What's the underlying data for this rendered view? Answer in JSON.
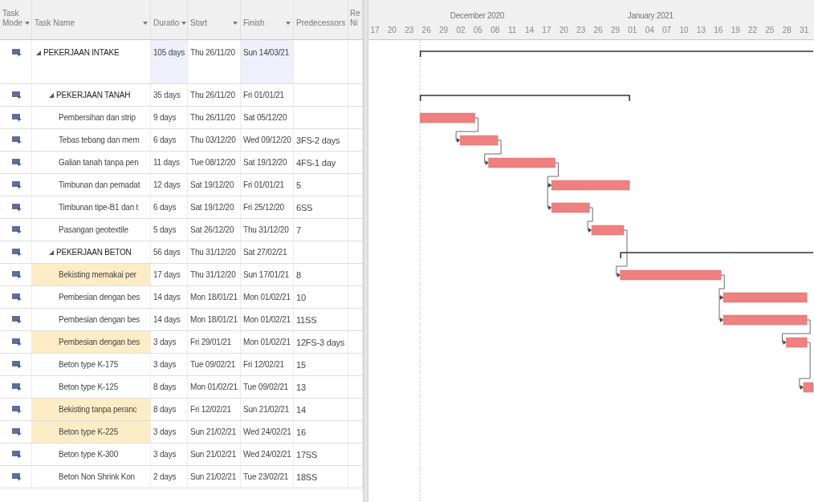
{
  "columns": [
    {
      "label": "Task Mode"
    },
    {
      "label": "Task Name"
    },
    {
      "label": "Duratio"
    },
    {
      "label": "Start"
    },
    {
      "label": "Finish"
    },
    {
      "label": "Predecessors"
    },
    {
      "label": "Re Ni"
    }
  ],
  "timeline": {
    "months": [
      "December 2020",
      "January 2021"
    ],
    "days": [
      "17",
      "20",
      "23",
      "26",
      "29",
      "02",
      "05",
      "08",
      "11",
      "14",
      "17",
      "20",
      "23",
      "26",
      "29",
      "01",
      "04",
      "07",
      "10",
      "13",
      "16",
      "19",
      "22",
      "25",
      "28",
      "31"
    ]
  },
  "tasks": [
    {
      "kind": "summary",
      "name": "PEKERJAAN INTAKE",
      "duration": "105 days",
      "start": "Thu 26/11/20",
      "finish": "Sun 14/03/21",
      "expanded": true,
      "name_highlighted": false,
      "dates_highlighted": true,
      "children": [
        {
          "kind": "summary",
          "name": "PEKERJAAN TANAH",
          "duration": "35 days",
          "start": "Thu 26/11/20",
          "finish": "Fri 01/01/21",
          "expanded": true,
          "name_highlighted": false,
          "dates_highlighted": false,
          "children": [
            {
              "kind": "task",
              "name": "Pembersihan dan strip",
              "duration": "9 days",
              "start": "Thu 26/11/20",
              "finish": "Sat 05/12/20",
              "name_highlighted": false,
              "dates_highlighted": false
            },
            {
              "kind": "task",
              "name": "Tebas tebang dan mem",
              "duration": "6 days",
              "start": "Thu 03/12/20",
              "finish": "Wed 09/12/20",
              "predecessors": "3FS-2 days",
              "name_highlighted": false,
              "dates_highlighted": false
            },
            {
              "kind": "task",
              "name": "Galian tanah tanpa pen",
              "duration": "11 days",
              "start": "Tue 08/12/20",
              "finish": "Sat 19/12/20",
              "predecessors": "4FS-1 day",
              "name_highlighted": false,
              "dates_highlighted": false
            },
            {
              "kind": "task",
              "name": "Timbunan dan pemadat",
              "duration": "12 days",
              "start": "Sat 19/12/20",
              "finish": "Fri 01/01/21",
              "predecessors": "5",
              "name_highlighted": false,
              "dates_highlighted": false
            },
            {
              "kind": "task",
              "name": "Timbunan tipe-B1 dan t",
              "duration": "6 days",
              "start": "Sat 19/12/20",
              "finish": "Fri 25/12/20",
              "predecessors": "6SS",
              "name_highlighted": false,
              "dates_highlighted": false
            },
            {
              "kind": "task",
              "name": "Pasangan geotextile",
              "duration": "5 days",
              "start": "Sat 26/12/20",
              "finish": "Thu 31/12/20",
              "predecessors": "7",
              "name_highlighted": false,
              "dates_highlighted": false
            }
          ]
        },
        {
          "kind": "summary",
          "name": "PEKERJAAN BETON",
          "duration": "56 days",
          "start": "Thu 31/12/20",
          "finish": "Sat 27/02/21",
          "expanded": true,
          "name_highlighted": false,
          "dates_highlighted": false,
          "children": [
            {
              "kind": "task",
              "name": "Bekisting memakai per",
              "duration": "17 days",
              "start": "Thu 31/12/20",
              "finish": "Sun 17/01/21",
              "predecessors": "8",
              "name_highlighted": true,
              "dates_highlighted": false
            },
            {
              "kind": "task",
              "name": "Pembesian dengan bes",
              "duration": "14 days",
              "start": "Mon 18/01/21",
              "finish": "Mon 01/02/21",
              "predecessors": "10",
              "name_highlighted": false,
              "dates_highlighted": false
            },
            {
              "kind": "task",
              "name": "Pembesian dengan bes",
              "duration": "14 days",
              "start": "Mon 18/01/21",
              "finish": "Mon 01/02/21",
              "predecessors": "11SS",
              "name_highlighted": false,
              "dates_highlighted": false
            },
            {
              "kind": "task",
              "name": "Pembesian dengan bes",
              "duration": "3 days",
              "start": "Fri 29/01/21",
              "finish": "Mon 01/02/21",
              "predecessors": "12FS-3 days",
              "name_highlighted": true,
              "dates_highlighted": false
            },
            {
              "kind": "task",
              "name": "Beton type K-175",
              "duration": "3 days",
              "start": "Tue 09/02/21",
              "finish": "Fri 12/02/21",
              "predecessors": "15",
              "name_highlighted": false,
              "dates_highlighted": false
            },
            {
              "kind": "task",
              "name": "Beton type K-125",
              "duration": "8 days",
              "start": "Mon 01/02/21",
              "finish": "Tue 09/02/21",
              "predecessors": "13",
              "name_highlighted": false,
              "dates_highlighted": false
            },
            {
              "kind": "task",
              "name": "Bekisting tanpa peranc",
              "duration": "8 days",
              "start": "Fri 12/02/21",
              "finish": "Sun 21/02/21",
              "predecessors": "14",
              "name_highlighted": true,
              "dates_highlighted": false
            },
            {
              "kind": "task",
              "name": "Beton type K-225",
              "duration": "3 days",
              "start": "Sun 21/02/21",
              "finish": "Wed 24/02/21",
              "predecessors": "16",
              "name_highlighted": true,
              "dates_highlighted": false
            },
            {
              "kind": "task",
              "name": "Beton type K-300",
              "duration": "3 days",
              "start": "Sun 21/02/21",
              "finish": "Wed 24/02/21",
              "predecessors": "17SS",
              "name_highlighted": false,
              "dates_highlighted": false
            },
            {
              "kind": "task",
              "name": "Beton Non Shrink Kon",
              "duration": "2 days",
              "start": "Sun 21/02/21",
              "finish": "Tue 23/02/21",
              "predecessors": "18SS",
              "name_highlighted": false,
              "dates_highlighted": false
            }
          ]
        }
      ]
    }
  ]
}
